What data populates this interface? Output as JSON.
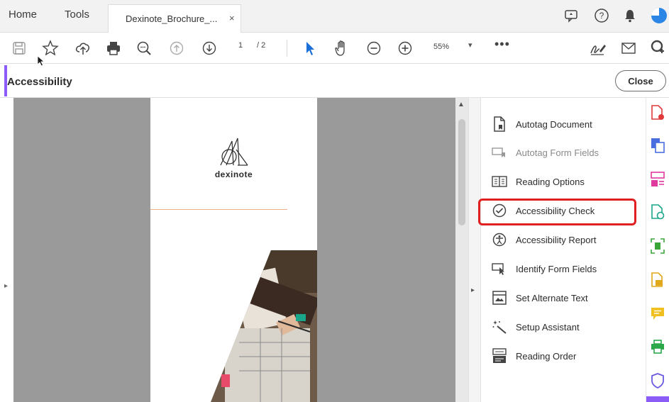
{
  "top_nav": {
    "home": "Home",
    "tools": "Tools"
  },
  "doc_tab": {
    "title": "Dexinote_Brochure_...",
    "close": "×"
  },
  "top_right_icons": [
    "comment-icon",
    "help-icon",
    "bell-icon",
    "profile-icon"
  ],
  "toolbar": {
    "page_current": "1",
    "page_total": "/ 2",
    "zoom": "55%",
    "zoom_caret": "▾",
    "more": "•••",
    "icons": [
      "save-icon",
      "star-icon",
      "upload-icon",
      "print-icon",
      "zoom-find-icon",
      "page-up-icon",
      "page-down-icon",
      "select-arrow-icon",
      "hand-icon",
      "zoom-out-icon",
      "zoom-in-icon",
      "sign-icon",
      "email-icon",
      "add-user-icon"
    ]
  },
  "panel_header": {
    "title": "Accessibility",
    "close": "Close"
  },
  "document": {
    "brand_name": "dexinote"
  },
  "tools": [
    {
      "label": "Autotag Document",
      "icon": "autotag-document-icon",
      "enabled": true
    },
    {
      "label": "Autotag Form Fields",
      "icon": "autotag-form-fields-icon",
      "enabled": false
    },
    {
      "label": "Reading Options",
      "icon": "reading-options-icon",
      "enabled": true
    },
    {
      "label": "Accessibility Check",
      "icon": "accessibility-check-icon",
      "enabled": true,
      "highlighted": true
    },
    {
      "label": "Accessibility Report",
      "icon": "accessibility-report-icon",
      "enabled": true
    },
    {
      "label": "Identify Form Fields",
      "icon": "identify-form-fields-icon",
      "enabled": true
    },
    {
      "label": "Set Alternate Text",
      "icon": "alternate-text-icon",
      "enabled": true
    },
    {
      "label": "Setup Assistant",
      "icon": "setup-assistant-icon",
      "enabled": true
    },
    {
      "label": "Reading Order",
      "icon": "reading-order-icon",
      "enabled": true
    }
  ],
  "rail_icons": [
    {
      "name": "create-pdf-icon",
      "color": "#e03a3a"
    },
    {
      "name": "export-pdf-icon",
      "color": "#4a6ee0"
    },
    {
      "name": "organize-pages-icon",
      "color": "#e03a9e"
    },
    {
      "name": "edit-pdf-icon",
      "color": "#1aa68a"
    },
    {
      "name": "scan-icon",
      "color": "#3aa63a"
    },
    {
      "name": "compress-icon",
      "color": "#e0a81a"
    },
    {
      "name": "comment-rail-icon",
      "color": "#f0c020"
    },
    {
      "name": "print-production-icon",
      "color": "#2aa84a"
    },
    {
      "name": "protect-icon",
      "color": "#6a5ae0"
    }
  ],
  "colors": {
    "accent": "#8b5cf6",
    "highlight": "#e02020",
    "doc_gray": "#9a9a9a"
  }
}
